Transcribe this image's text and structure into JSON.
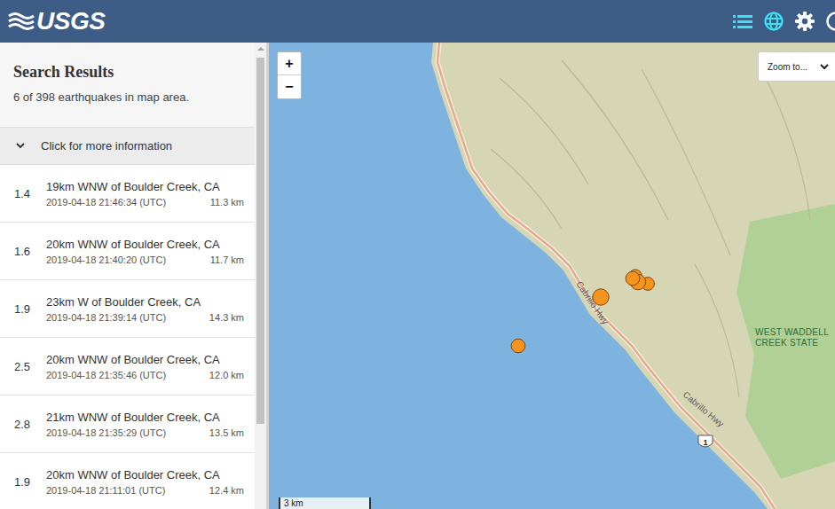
{
  "header": {
    "logo": "USGS",
    "buttons": [
      {
        "kind": "list",
        "active": true
      },
      {
        "kind": "globe",
        "active": true
      },
      {
        "kind": "settings",
        "active": false
      },
      {
        "kind": "help",
        "active": false
      }
    ]
  },
  "search_results": {
    "title": "Search Results",
    "summary": "6 of 398 earthquakes in map area.",
    "more_info": {
      "label": "Click for more information",
      "expanded": false
    }
  },
  "earthquakes": [
    {
      "magnitude": "1.4",
      "place": "19km WNW of Boulder Creek, CA",
      "time": "2019-04-18 21:46:34 (UTC)",
      "depth": "11.3 km"
    },
    {
      "magnitude": "1.6",
      "place": "20km WNW of Boulder Creek, CA",
      "time": "2019-04-18 21:40:20 (UTC)",
      "depth": "11.7 km"
    },
    {
      "magnitude": "1.9",
      "place": "23km W of Boulder Creek, CA",
      "time": "2019-04-18 21:39:14 (UTC)",
      "depth": "14.3 km"
    },
    {
      "magnitude": "2.5",
      "place": "20km WNW of Boulder Creek, CA",
      "time": "2019-04-18 21:35:46 (UTC)",
      "depth": "12.0 km"
    },
    {
      "magnitude": "2.8",
      "place": "21km WNW of Boulder Creek, CA",
      "time": "2019-04-18 21:35:29 (UTC)",
      "depth": "13.5 km"
    },
    {
      "magnitude": "1.9",
      "place": "20km WNW of Boulder Creek, CA",
      "time": "2019-04-18 21:11:01 (UTC)",
      "depth": "12.4 km"
    }
  ],
  "map": {
    "zoom_in": "+",
    "zoom_out": "−",
    "zoom_menu": "Zoom to...",
    "road_labels": [
      "Cabrillo Hwy",
      "Cabrillo Hwy"
    ],
    "park_label": [
      "WEST WADDELL",
      "CREEK STATE"
    ],
    "route_shield": "1",
    "scale": "3 km"
  }
}
